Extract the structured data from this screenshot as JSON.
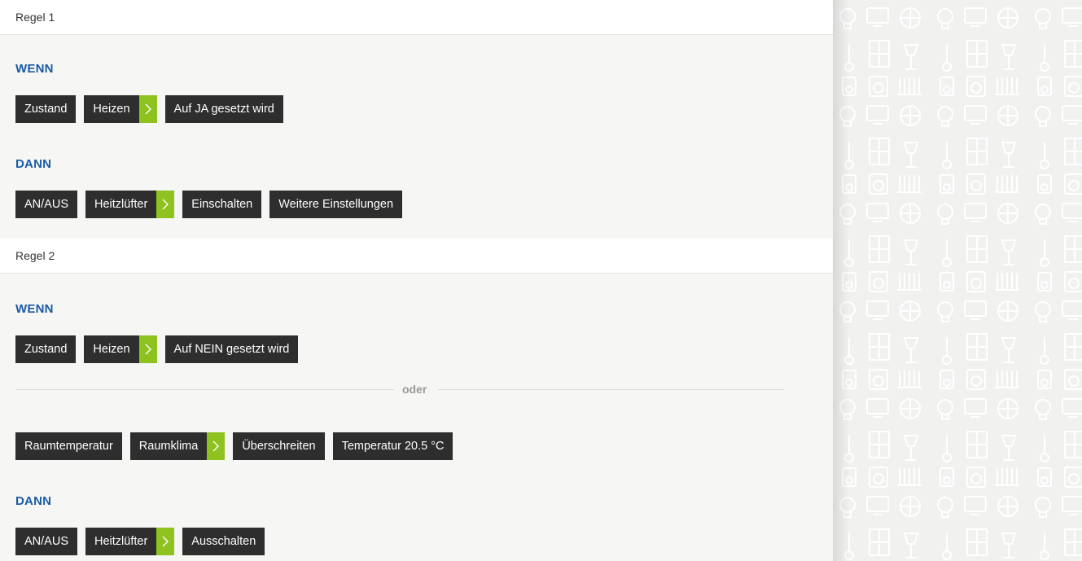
{
  "rules": [
    {
      "title": "Regel 1",
      "when_label": "WENN",
      "when": {
        "chip1": "Zustand",
        "chip2": "Heizen",
        "chip3": "Auf JA gesetzt wird"
      },
      "then_label": "DANN",
      "then": {
        "chip1": "AN/AUS",
        "chip2": "Heitzlüfter",
        "chip3": "Einschalten",
        "chip4": "Weitere Einstellungen"
      }
    },
    {
      "title": "Regel 2",
      "when_label": "WENN",
      "when": {
        "chip1": "Zustand",
        "chip2": "Heizen",
        "chip3": "Auf NEIN gesetzt wird"
      },
      "or_label": "oder",
      "when_alt": {
        "chip1": "Raumtemperatur",
        "chip2": "Raumklima",
        "chip3": "Überschreiten",
        "chip4": "Temperatur 20.5 °C"
      },
      "then_label": "DANN",
      "then": {
        "chip1": "AN/AUS",
        "chip2": "Heitzlüfter",
        "chip3": "Ausschalten"
      }
    }
  ],
  "icons": {
    "device_selector": "chevron-right-icon",
    "background": "smart-home-device-pattern"
  },
  "colors": {
    "section_label": "#1a5aa6",
    "chip_bg": "#2e2e2e",
    "chip_arrow": "#8dc21f",
    "panel_bg": "#f6f6f4",
    "header_bg": "#ffffff"
  }
}
